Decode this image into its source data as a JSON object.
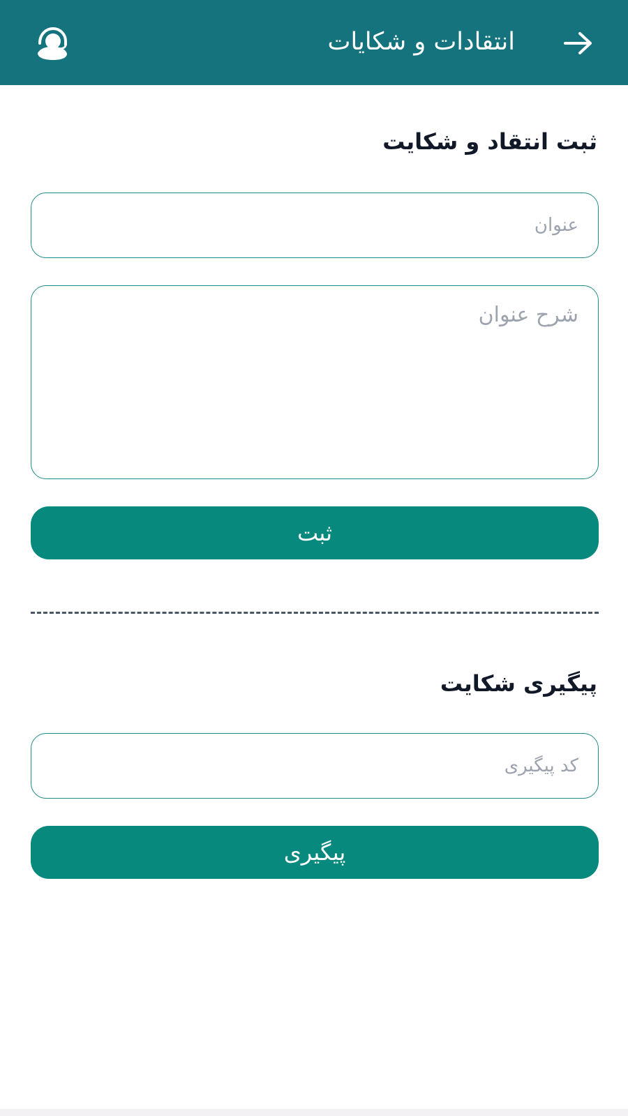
{
  "header": {
    "title": "انتقادات و شکایات",
    "back_icon": "arrow-right-icon",
    "support_icon": "support-headset-icon",
    "background": "#14737d"
  },
  "complaint_form": {
    "heading": "ثبت انتقاد و شکایت",
    "title_placeholder": "عنوان",
    "description_placeholder": "شرح عنوان",
    "submit_label": "ثبت"
  },
  "tracking": {
    "heading": "پیگیری شکایت",
    "code_placeholder": "کد پیگیری",
    "track_label": "پیگیری"
  },
  "colors": {
    "accent": "#078a7d",
    "field_border": "#1f8a87",
    "divider": "#4b5563",
    "placeholder": "#9ca3af"
  }
}
